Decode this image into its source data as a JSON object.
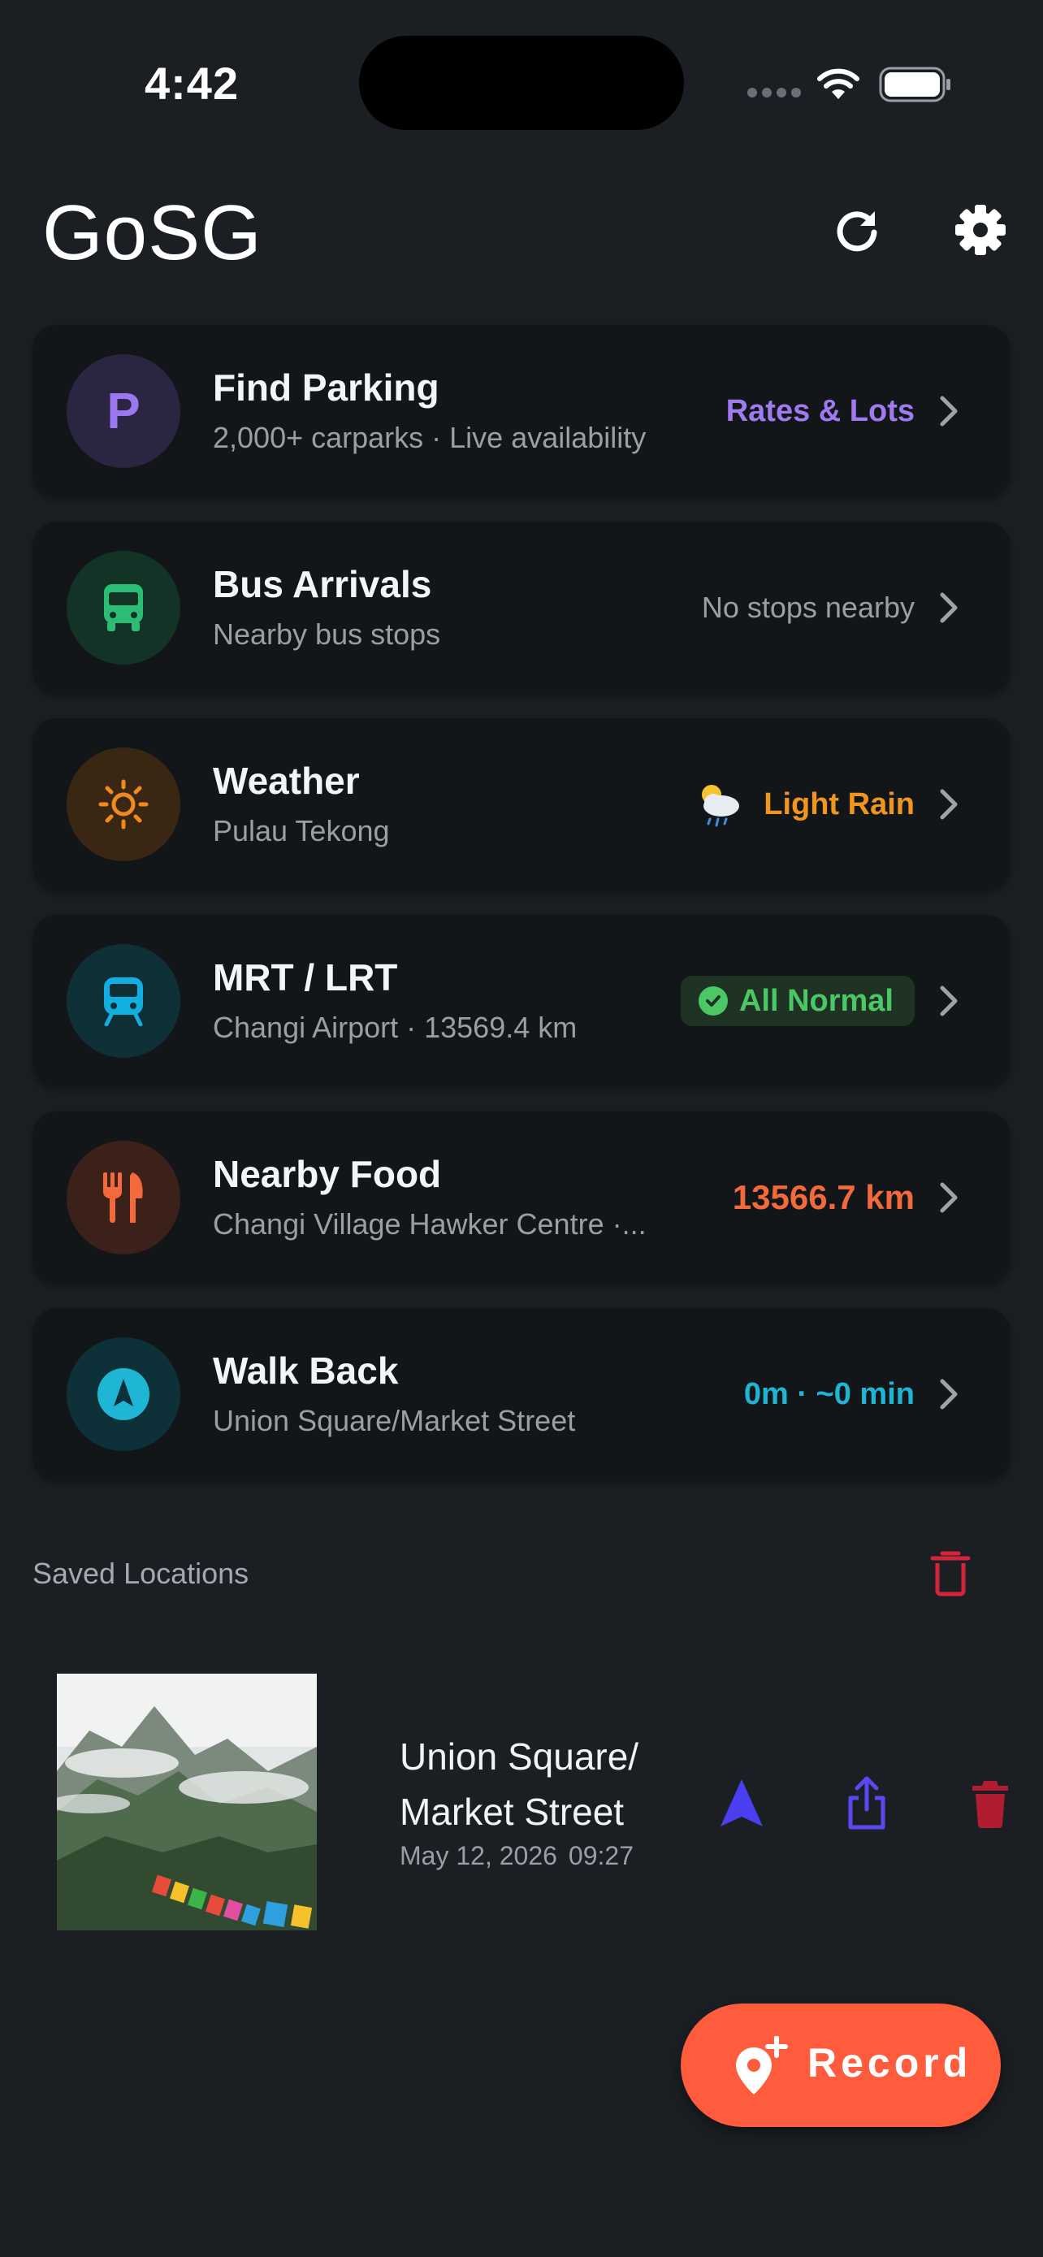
{
  "status_bar": {
    "time": "4:42"
  },
  "header": {
    "title": "GoSG"
  },
  "cards": [
    {
      "icon_text": "P",
      "title": "Find Parking",
      "subtitle": "2,000+ carparks · Live availability",
      "right": "Rates & Lots",
      "right_color": "#a07bf0"
    },
    {
      "title": "Bus Arrivals",
      "subtitle": "Nearby bus stops",
      "right": "No stops nearby",
      "right_color": "#9a9fa6"
    },
    {
      "title": "Weather",
      "subtitle": "Pulau Tekong",
      "right": "Light Rain",
      "right_color": "#f0961f"
    },
    {
      "title": "MRT / LRT",
      "subtitle": "Changi Airport · 13569.4 km",
      "right": "All Normal",
      "right_color": "#4cc766"
    },
    {
      "title": "Nearby Food",
      "subtitle": "Changi Village Hawker Centre ·...",
      "right": "13566.7 km",
      "right_color": "#f26a3b"
    },
    {
      "title": "Walk Back",
      "subtitle": "Union Square/Market Street",
      "right": "0m · ~0 min",
      "right_color": "#1fb6d6"
    }
  ],
  "saved": {
    "label": "Saved Locations",
    "item": {
      "name": "Union Square/ Market Street",
      "date": "May 12, 2026",
      "time": "09:27"
    }
  },
  "fab": {
    "label": "Record"
  }
}
